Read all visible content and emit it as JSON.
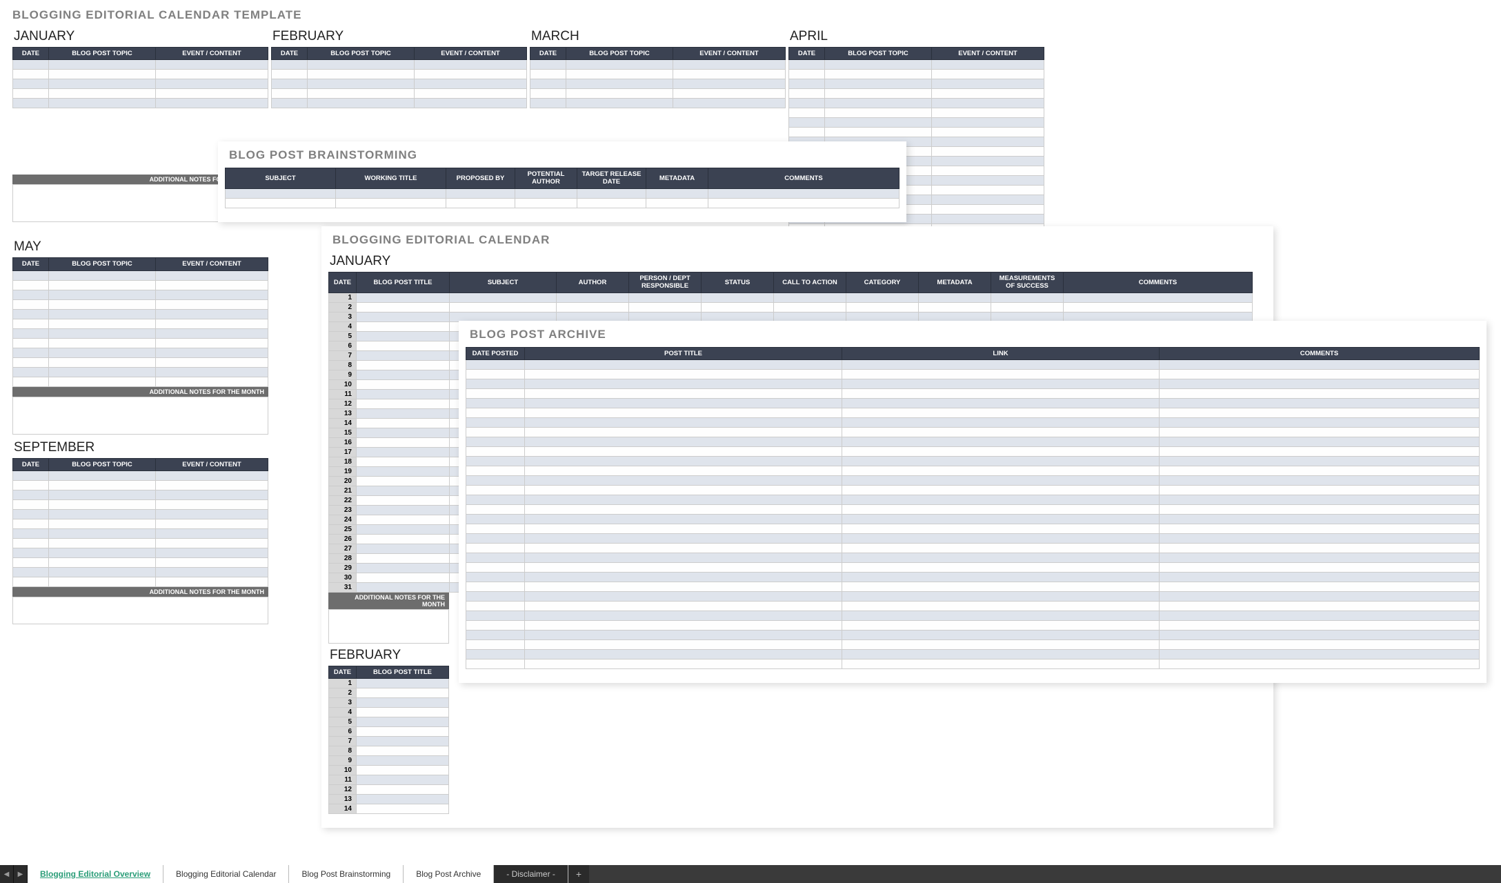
{
  "template_title": "BLOGGING EDITORIAL CALENDAR TEMPLATE",
  "overview": {
    "months_row1": [
      "JANUARY",
      "FEBRUARY",
      "MARCH",
      "APRIL"
    ],
    "months_row2": [
      "MAY"
    ],
    "months_row3": [
      "SEPTEMBER"
    ],
    "cols": [
      "DATE",
      "BLOG POST TOPIC",
      "EVENT / CONTENT"
    ],
    "notes_label": "ADDITIONAL NOTES FOR THE MONTH"
  },
  "brainstorming": {
    "title": "BLOG POST BRAINSTORMING",
    "cols": [
      "SUBJECT",
      "WORKING TITLE",
      "PROPOSED BY",
      "POTENTIAL AUTHOR",
      "TARGET RELEASE DATE",
      "METADATA",
      "COMMENTS"
    ]
  },
  "calendar": {
    "title": "BLOGGING EDITORIAL CALENDAR",
    "month1": "JANUARY",
    "month2": "FEBRUARY",
    "cols": [
      "DATE",
      "BLOG POST TITLE",
      "SUBJECT",
      "AUTHOR",
      "PERSON / DEPT RESPONSIBLE",
      "STATUS",
      "CALL TO ACTION",
      "CATEGORY",
      "METADATA",
      "MEASUREMENTS OF SUCCESS",
      "COMMENTS"
    ],
    "notes_label": "ADDITIONAL NOTES FOR THE MONTH",
    "days_jan": [
      "1",
      "2",
      "3",
      "4",
      "5",
      "6",
      "7",
      "8",
      "9",
      "10",
      "11",
      "12",
      "13",
      "14",
      "15",
      "16",
      "17",
      "18",
      "19",
      "20",
      "21",
      "22",
      "23",
      "24",
      "25",
      "26",
      "27",
      "28",
      "29",
      "30",
      "31"
    ],
    "days_feb": [
      "1",
      "2",
      "3",
      "4",
      "5",
      "6",
      "7",
      "8",
      "9",
      "10",
      "11",
      "12",
      "13",
      "14"
    ]
  },
  "archive": {
    "title": "BLOG POST ARCHIVE",
    "cols": [
      "DATE POSTED",
      "POST TITLE",
      "LINK",
      "COMMENTS"
    ]
  },
  "tabs": {
    "items": [
      "Blogging Editorial Overview",
      "Blogging Editorial Calendar",
      "Blog Post Brainstorming",
      "Blog Post Archive",
      "- Disclaimer -"
    ],
    "active": 0
  }
}
